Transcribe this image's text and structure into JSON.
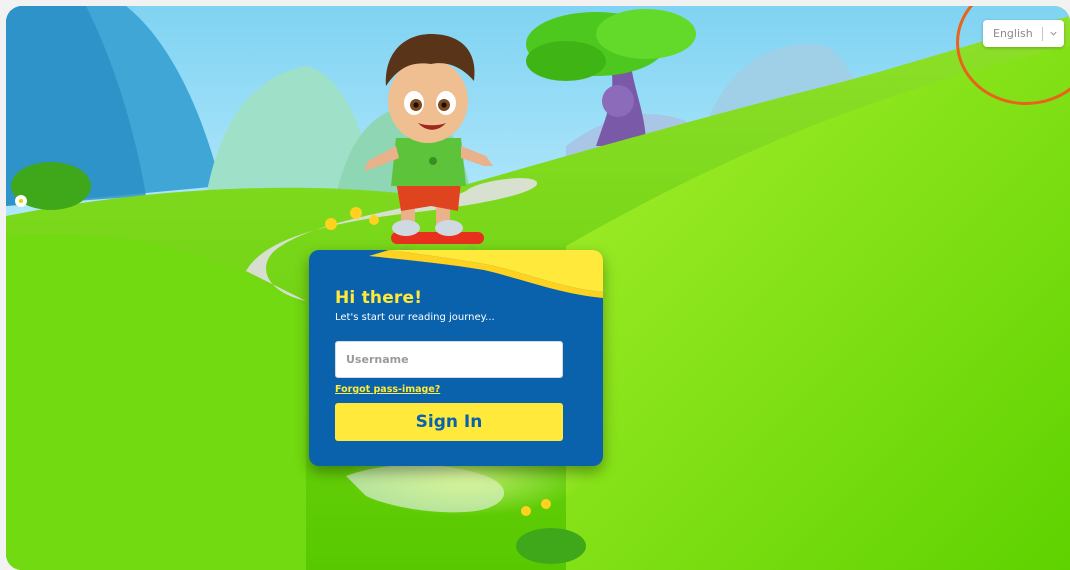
{
  "language_selector": {
    "selected": "English",
    "chevron_icon": "chevron-down-icon"
  },
  "login": {
    "greeting": "Hi there!",
    "subtitle": "Let's start our reading journey...",
    "username_placeholder": "Username",
    "username_value": "",
    "forgot_link": "Forgot pass-image?",
    "sign_in_label": "Sign In"
  },
  "colors": {
    "card_blue": "#0a62ad",
    "accent_yellow": "#ffe93a",
    "grass_green": "#5fd100",
    "highlight_orange": "#e8641b"
  }
}
